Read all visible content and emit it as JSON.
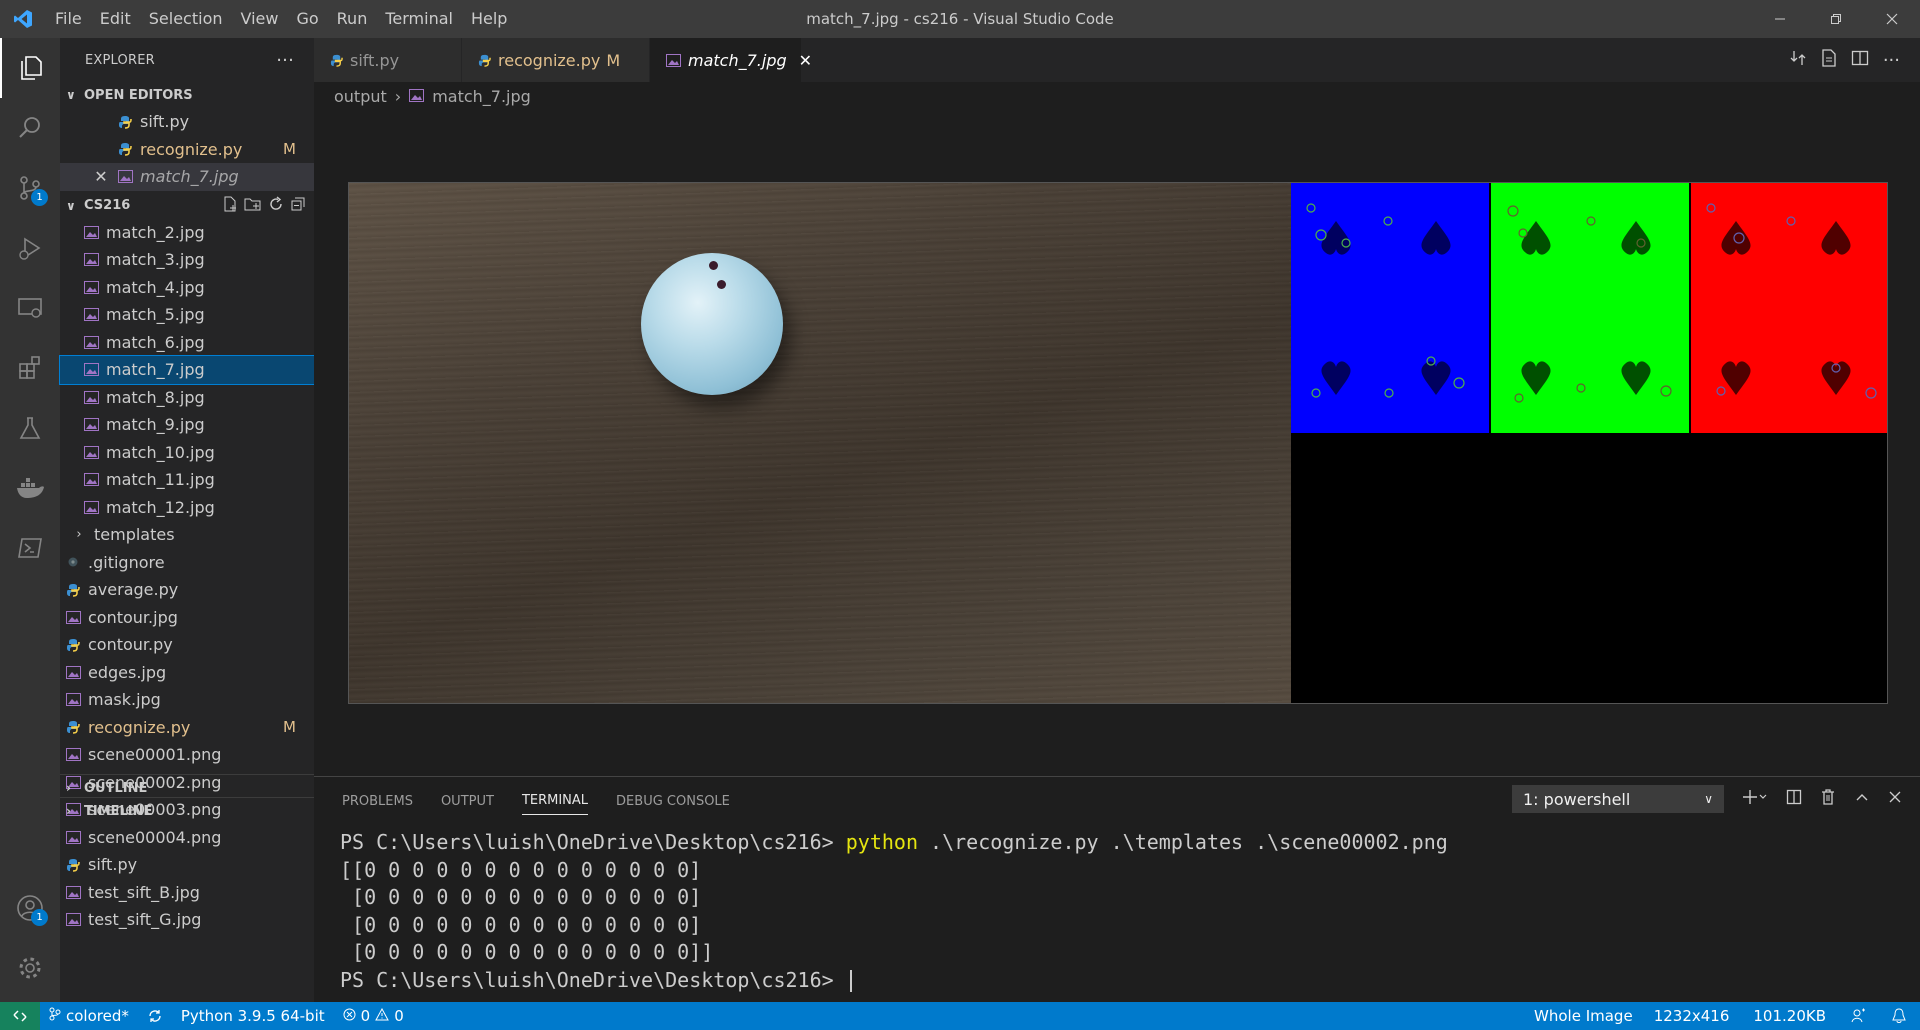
{
  "titlebar": {
    "menu": [
      "File",
      "Edit",
      "Selection",
      "View",
      "Go",
      "Run",
      "Terminal",
      "Help"
    ],
    "title": "match_7.jpg - cs216 - Visual Studio Code"
  },
  "sidebar": {
    "title": "EXPLORER",
    "open_editors": {
      "label": "OPEN EDITORS",
      "items": [
        {
          "name": "sift.py",
          "type": "py"
        },
        {
          "name": "recognize.py",
          "type": "py",
          "status": "M"
        },
        {
          "name": "match_7.jpg",
          "type": "img"
        }
      ]
    },
    "folder": {
      "label": "CS216",
      "output_files": [
        "match_2.jpg",
        "match_3.jpg",
        "match_4.jpg",
        "match_5.jpg",
        "match_6.jpg",
        "match_7.jpg",
        "match_8.jpg",
        "match_9.jpg",
        "match_10.jpg",
        "match_11.jpg",
        "match_12.jpg"
      ],
      "templates_label": "templates",
      "root_files": [
        {
          "name": ".gitignore",
          "type": "git"
        },
        {
          "name": "average.py",
          "type": "py"
        },
        {
          "name": "contour.jpg",
          "type": "img"
        },
        {
          "name": "contour.py",
          "type": "py"
        },
        {
          "name": "edges.jpg",
          "type": "img"
        },
        {
          "name": "mask.jpg",
          "type": "img"
        },
        {
          "name": "recognize.py",
          "type": "py",
          "status": "M"
        },
        {
          "name": "scene00001.png",
          "type": "img"
        },
        {
          "name": "scene00002.png",
          "type": "img"
        },
        {
          "name": "scene00003.png",
          "type": "img"
        },
        {
          "name": "scene00004.png",
          "type": "img"
        },
        {
          "name": "sift.py",
          "type": "py"
        },
        {
          "name": "test_sift_B.jpg",
          "type": "img"
        },
        {
          "name": "test_sift_G.jpg",
          "type": "img"
        }
      ]
    },
    "outline_label": "OUTLINE",
    "timeline_label": "TIMELINE"
  },
  "tabs": [
    {
      "label": "sift.py",
      "type": "py"
    },
    {
      "label": "recognize.py",
      "type": "py",
      "status": "M"
    },
    {
      "label": "match_7.jpg",
      "type": "img"
    }
  ],
  "breadcrumb": {
    "folder": "output",
    "file": "match_7.jpg"
  },
  "panel": {
    "tabs": [
      "PROBLEMS",
      "OUTPUT",
      "TERMINAL",
      "DEBUG CONSOLE"
    ],
    "active_tab": "TERMINAL",
    "terminal_select": "1: powershell",
    "terminal": {
      "prompt": "PS C:\\Users\\luish\\OneDrive\\Desktop\\cs216> ",
      "command": "python",
      "args": " .\\recognize.py .\\templates .\\scene00002.png",
      "output": [
        "[[0 0 0 0 0 0 0 0 0 0 0 0 0 0]",
        " [0 0 0 0 0 0 0 0 0 0 0 0 0 0]",
        " [0 0 0 0 0 0 0 0 0 0 0 0 0 0]",
        " [0 0 0 0 0 0 0 0 0 0 0 0 0 0]]"
      ],
      "final_prompt": "PS C:\\Users\\luish\\OneDrive\\Desktop\\cs216> "
    }
  },
  "statusbar": {
    "branch": "colored*",
    "python": "Python 3.9.5 64-bit",
    "errors": "0",
    "warnings": "0",
    "image_mode": "Whole Image",
    "dimensions": "1232x416",
    "size": "101.20KB"
  },
  "badges": {
    "source_control": "1",
    "accounts": "1"
  },
  "colors": {
    "accent": "#007acc",
    "modified": "#e2c08d",
    "card_blue": "#0000ff",
    "card_green": "#00ff00",
    "card_red": "#ff0000"
  }
}
